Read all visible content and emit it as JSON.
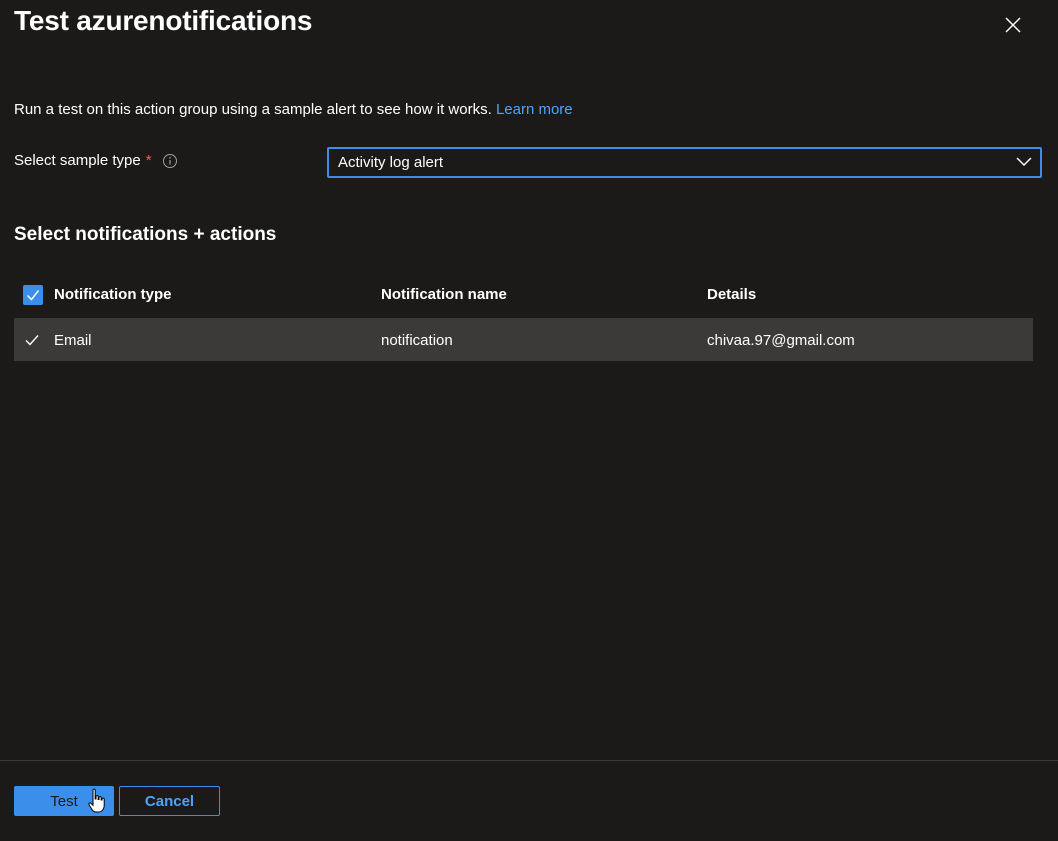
{
  "dialog": {
    "title": "Test azurenotifications",
    "description": "Run a test on this action group using a sample alert to see how it works.",
    "learn_more": "Learn more"
  },
  "sample_type": {
    "label": "Select sample type",
    "required_mark": "*",
    "selected": "Activity log alert"
  },
  "section": {
    "heading": "Select notifications + actions"
  },
  "table": {
    "columns": [
      "Notification type",
      "Notification name",
      "Details"
    ],
    "select_all_checked": true,
    "rows": [
      {
        "type": "Email",
        "name": "notification",
        "details": "chivaa.97@gmail.com",
        "checked": true
      }
    ]
  },
  "footer": {
    "test_label": "Test",
    "cancel_label": "Cancel"
  },
  "colors": {
    "background": "#1b1a19",
    "accent": "#3b8eea",
    "link": "#4da3ff",
    "row_highlight": "#3b3a39",
    "required": "#ff5757"
  },
  "icons": [
    "close-icon",
    "info-icon",
    "chevron-down-icon",
    "checkmark-icon",
    "hand-cursor-icon"
  ]
}
